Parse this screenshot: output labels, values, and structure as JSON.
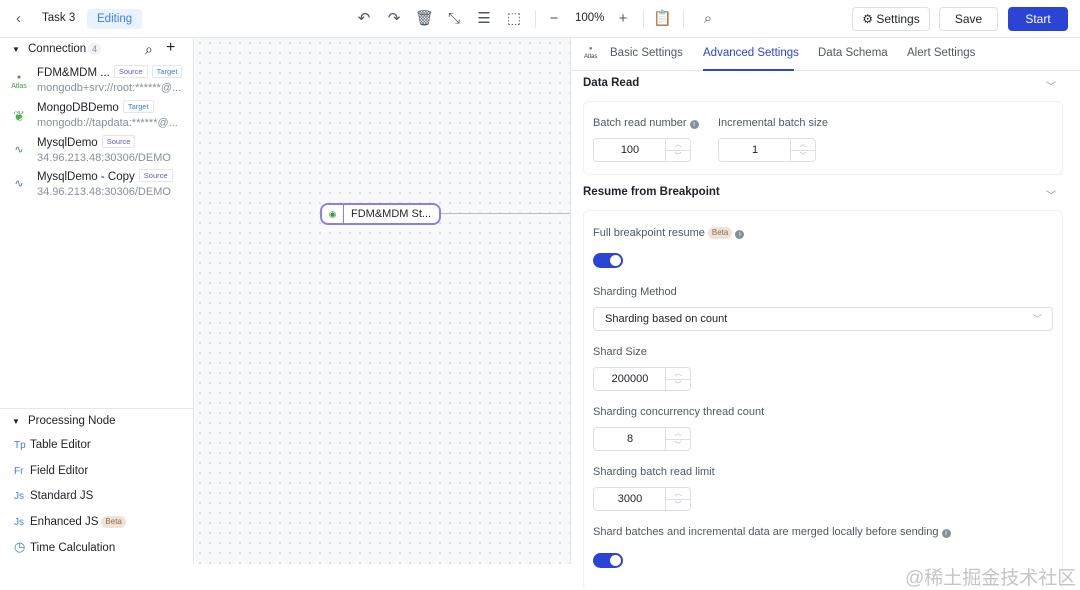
{
  "header": {
    "task_name": "Task 3",
    "status": "Editing",
    "zoom": "100%",
    "settings": "Settings",
    "save": "Save",
    "start": "Start"
  },
  "sidebar": {
    "connection_title": "Connection",
    "connection_count": "4",
    "connections": [
      {
        "name": "FDM&MDM ...",
        "tags": [
          "Source",
          "Target"
        ],
        "uri": "mongodb+srv://root:******@...",
        "icon": "atlas-icon"
      },
      {
        "name": "MongoDBDemo",
        "tags": [
          "Target"
        ],
        "uri": "mongodb://tapdata:******@...",
        "icon": "mongodb-leaf-icon"
      },
      {
        "name": "MysqlDemo",
        "tags": [
          "Source"
        ],
        "uri": "34.96.213.48:30306/DEMO",
        "icon": "mysql-dolphin-icon"
      },
      {
        "name": "MysqlDemo - Copy",
        "tags": [
          "Source"
        ],
        "uri": "34.96.213.48:30306/DEMO",
        "icon": "mysql-dolphin-icon"
      }
    ],
    "processing_title": "Processing Node",
    "processing_nodes": [
      {
        "icon_text": "Tp",
        "label": "Table Editor"
      },
      {
        "icon_text": "Fr",
        "label": "Field Editor"
      },
      {
        "icon_text": "Js",
        "label": "Standard JS"
      },
      {
        "icon_text": "Js",
        "label": "Enhanced JS",
        "badge": "Beta"
      },
      {
        "icon_text": "◷",
        "label": "Time Calculation"
      }
    ]
  },
  "canvas": {
    "node_label": "FDM&MDM St..."
  },
  "panel": {
    "tabs": [
      "Basic Settings",
      "Advanced Settings",
      "Data Schema",
      "Alert Settings"
    ],
    "active_tab": "Advanced Settings",
    "data_read": {
      "title": "Data Read",
      "batch_read_label": "Batch read number",
      "batch_read_value": "100",
      "incremental_label": "Incremental batch size",
      "incremental_value": "1"
    },
    "resume": {
      "title": "Resume from Breakpoint",
      "full_resume_label": "Full breakpoint resume",
      "beta": "Beta",
      "full_resume_on": true,
      "sharding_method_label": "Sharding Method",
      "sharding_method_value": "Sharding based on count",
      "shard_size_label": "Shard Size",
      "shard_size_value": "200000",
      "thread_label": "Sharding concurrency thread count",
      "thread_value": "8",
      "batch_limit_label": "Sharding batch read limit",
      "batch_limit_value": "3000",
      "merge_label": "Shard batches and incremental data are merged locally before sending",
      "merge_on": true
    }
  },
  "watermark": "@稀土掘金技术社区",
  "colors": {
    "primary": "#2c44d5",
    "status_bg": "#e8f3ff"
  }
}
